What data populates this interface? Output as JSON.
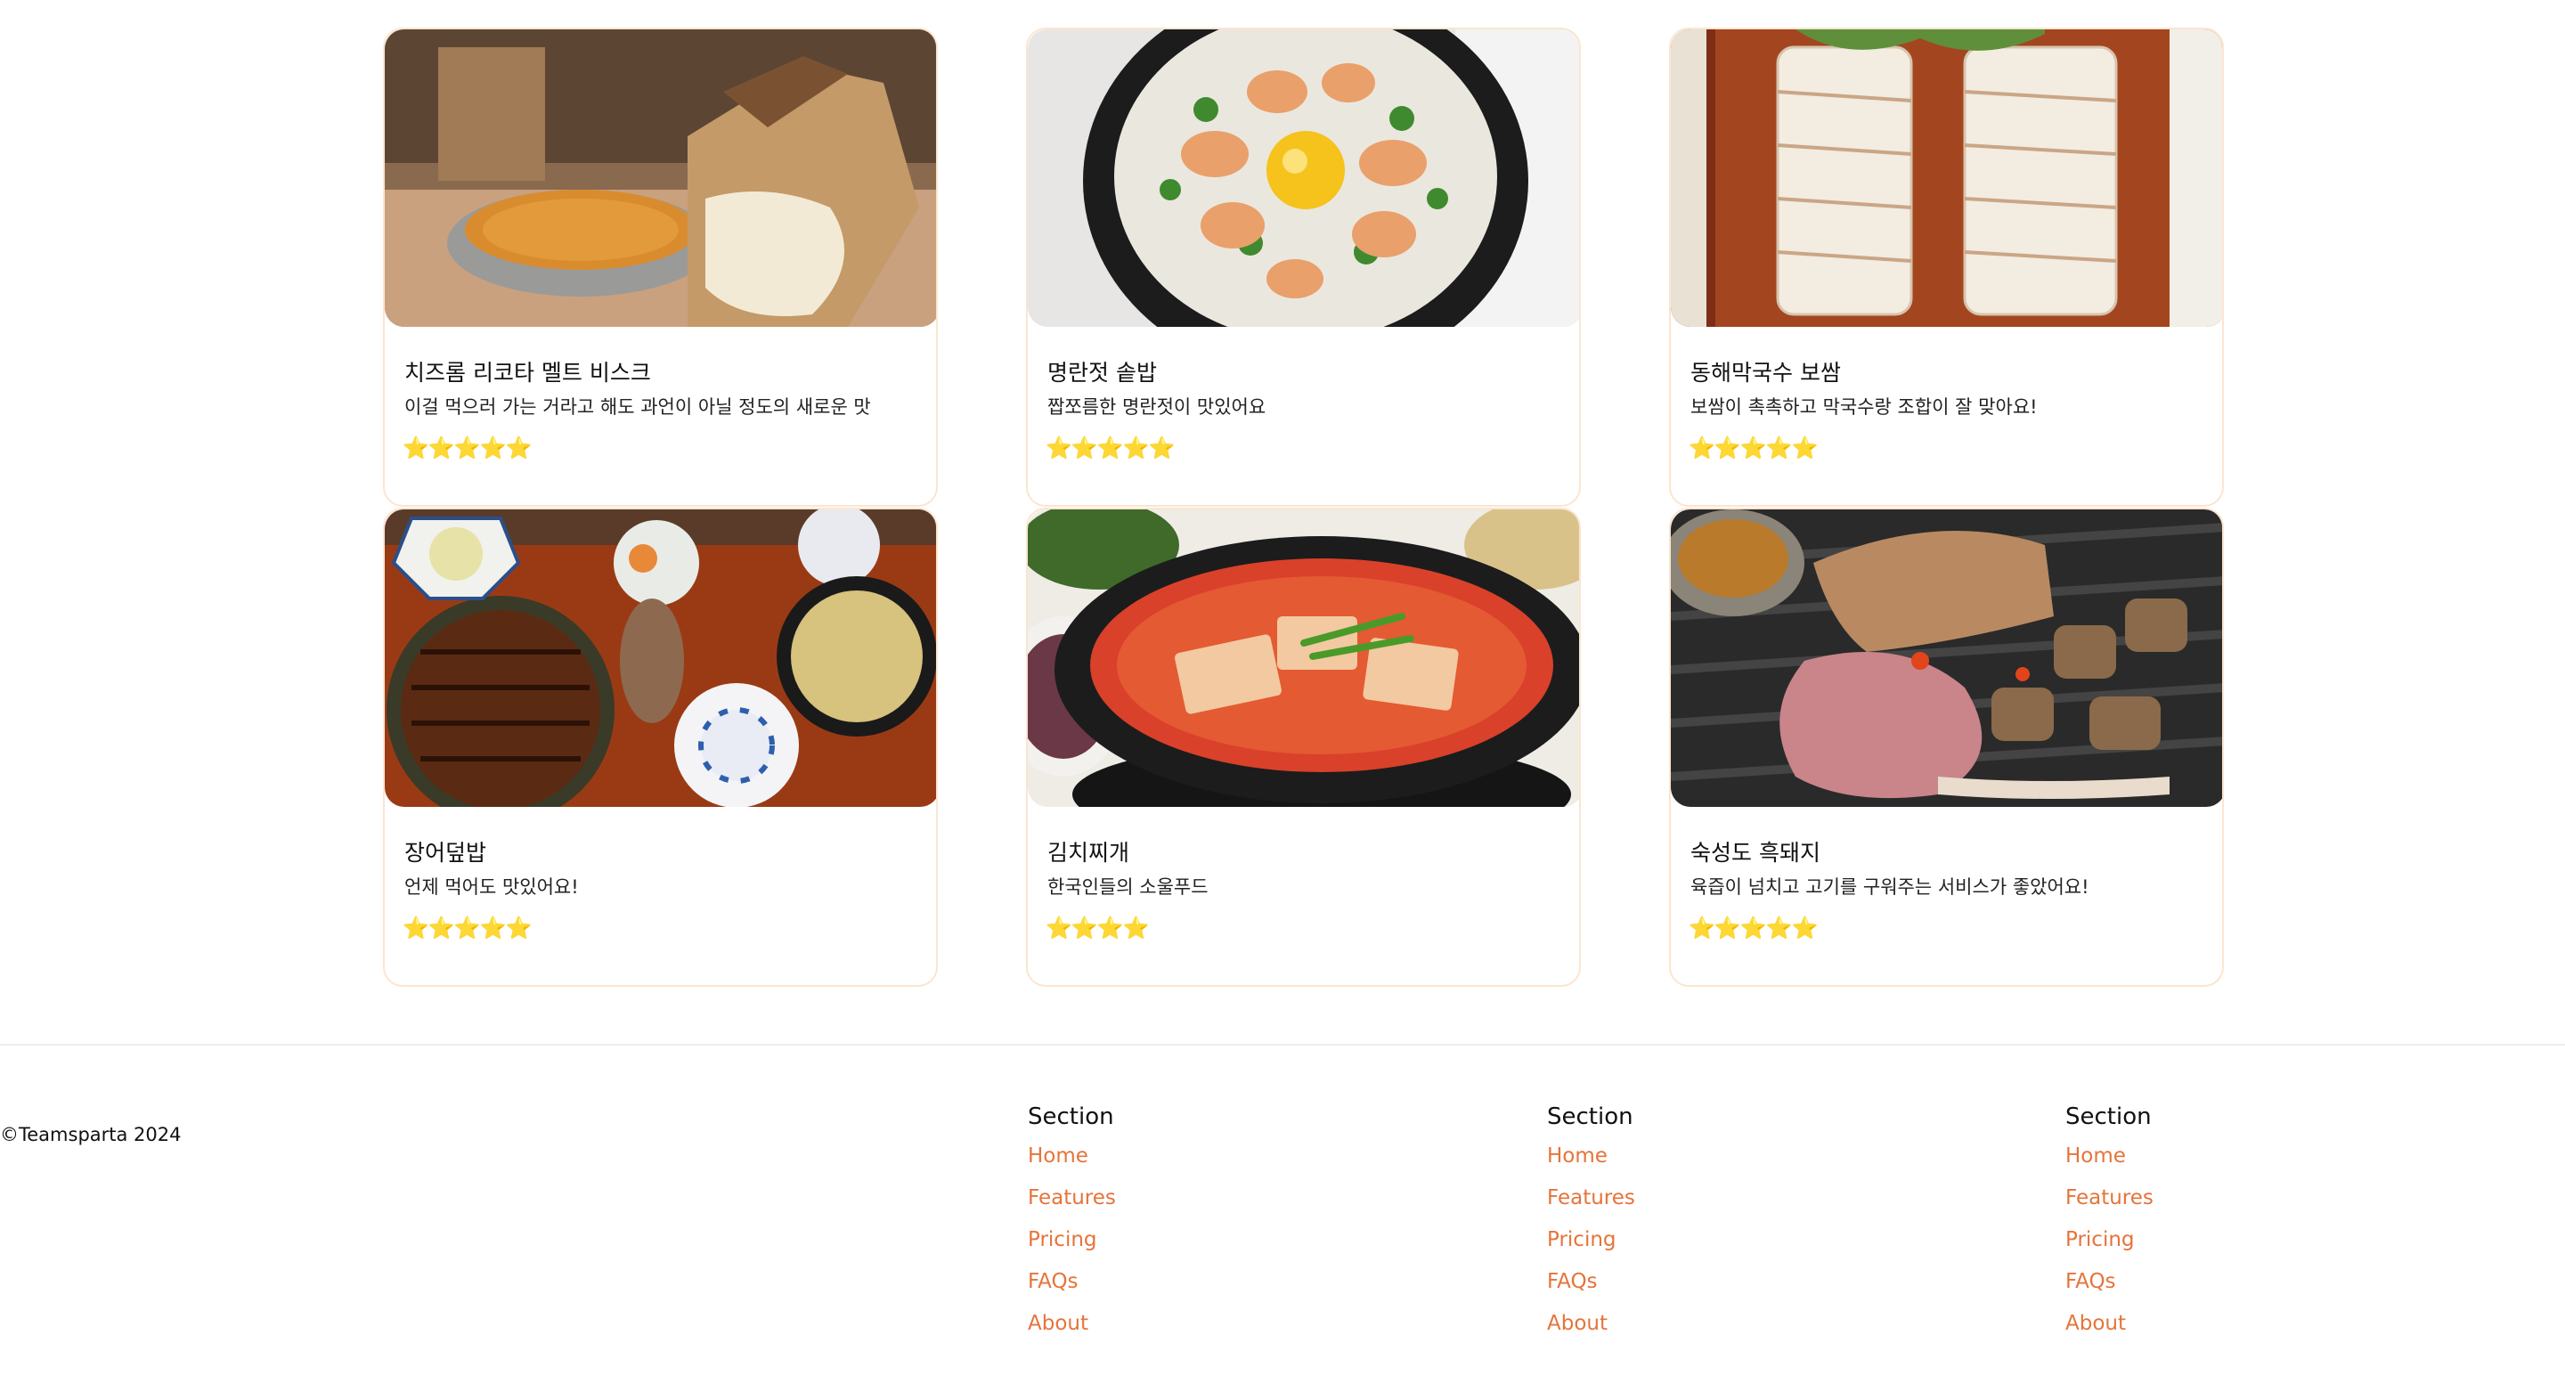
{
  "cards": [
    {
      "title": "치즈롬 리코타 멜트 비스크",
      "text": "이걸 먹으러 가는 거라고 해도 과언이 아닐 정도의 새로운 맛",
      "stars": "⭐⭐⭐⭐⭐"
    },
    {
      "title": "명란젓 솥밥",
      "text": "짭쪼름한 명란젓이 맛있어요",
      "stars": "⭐⭐⭐⭐⭐"
    },
    {
      "title": "동해막국수 보쌈",
      "text": "보쌈이 촉촉하고 막국수랑 조합이 잘 맞아요!",
      "stars": "⭐⭐⭐⭐⭐"
    },
    {
      "title": "장어덮밥",
      "text": "언제 먹어도 맛있어요!",
      "stars": "⭐⭐⭐⭐⭐"
    },
    {
      "title": "김치찌개",
      "text": "한국인들의 소울푸드",
      "stars": "⭐⭐⭐⭐"
    },
    {
      "title": "숙성도 흑돼지",
      "text": "육즙이 넘치고 고기를 구워주는 서비스가 좋았어요!",
      "stars": "⭐⭐⭐⭐⭐"
    }
  ],
  "footer": {
    "copyright": "©Teamsparta 2024",
    "columns": [
      {
        "title": "Section",
        "links": [
          "Home",
          "Features",
          "Pricing",
          "FAQs",
          "About"
        ]
      },
      {
        "title": "Section",
        "links": [
          "Home",
          "Features",
          "Pricing",
          "FAQs",
          "About"
        ]
      },
      {
        "title": "Section",
        "links": [
          "Home",
          "Features",
          "Pricing",
          "FAQs",
          "About"
        ]
      }
    ]
  },
  "colors": {
    "link": "#e5743a",
    "card_border": "#fbe5d0"
  }
}
